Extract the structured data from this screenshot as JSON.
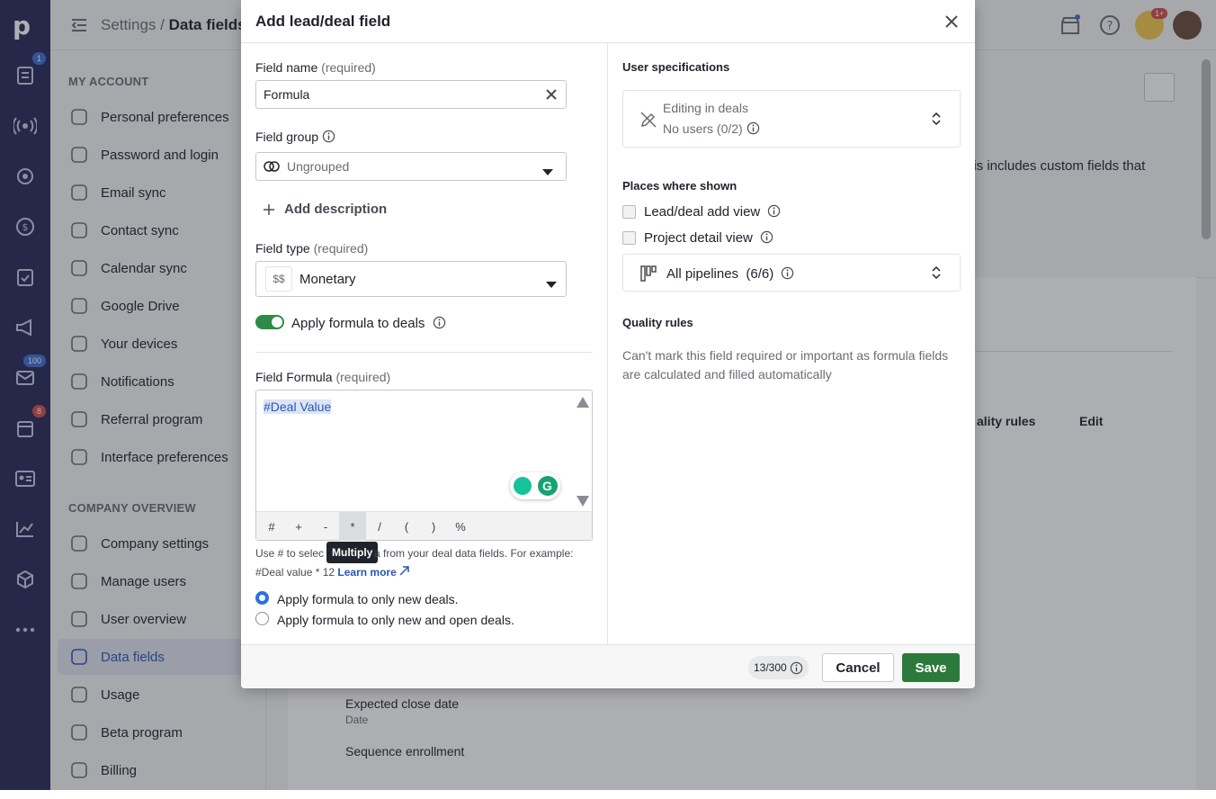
{
  "rail": {
    "badges": {
      "leads": "1",
      "mail": "100",
      "calendar": "8"
    }
  },
  "topbar": {
    "crumb_parent": "Settings",
    "crumb_sep": "/",
    "crumb_current": "Data fields",
    "bulb_badge": "1+"
  },
  "sidebar": {
    "section_account": "MY ACCOUNT",
    "account_items": [
      "Personal preferences",
      "Password and login",
      "Email sync",
      "Contact sync",
      "Calendar sync",
      "Google Drive",
      "Your devices",
      "Notifications",
      "Referral program",
      "Interface preferences"
    ],
    "section_company": "COMPANY OVERVIEW",
    "company_items": [
      "Company settings",
      "Manage users",
      "User overview",
      "Data fields",
      "Usage",
      "Beta program",
      "Billing"
    ]
  },
  "background": {
    "desc_fragment": "his includes custom fields that",
    "col_quality": "ality rules",
    "col_edit": "Edit",
    "rows": [
      {
        "name": "Expected close date",
        "type": "Date"
      },
      {
        "name": "Sequence enrollment",
        "type": ""
      }
    ]
  },
  "modal": {
    "title": "Add lead/deal field",
    "field_name_label": "Field name",
    "required": "(required)",
    "field_name_value": "Formula",
    "field_group_label": "Field group",
    "field_group_value": "Ungrouped",
    "add_description": "Add description",
    "field_type_label": "Field type",
    "field_type_icon": "$$",
    "field_type_value": "Monetary",
    "apply_formula_label": "Apply formula to deals",
    "apply_formula_on": true,
    "formula_label": "Field Formula",
    "formula_value": "#Deal Value",
    "toolbar": [
      "#",
      "+",
      "-",
      "*",
      "/",
      "(",
      ")",
      "%"
    ],
    "tooltip": "Multiply",
    "help_line1_a": "Use # to selec",
    "help_line1_b": "a from your deal data fields. For example:",
    "help_line2": "#Deal value * 12",
    "learn_more": "Learn more",
    "radio_options": [
      "Apply formula to only new deals.",
      "Apply formula to only new and open deals."
    ],
    "radio_selected": 0,
    "user_specs_title": "User specifications",
    "editing_title": "Editing in deals",
    "editing_sub": "No users (0/2)",
    "places_title": "Places where shown",
    "places": [
      "Lead/deal add view",
      "Project detail view"
    ],
    "pipelines_label": "All pipelines",
    "pipelines_count": "(6/6)",
    "quality_title": "Quality rules",
    "quality_text": "Can't mark this field required or important as formula fields are calculated and filled automatically",
    "char_count": "13/300",
    "cancel": "Cancel",
    "save": "Save"
  },
  "colors": {
    "accent": "#2b55b8",
    "save_green": "#2b7a3b",
    "toggle_green": "#2e8b46",
    "rail": "#26285a"
  }
}
